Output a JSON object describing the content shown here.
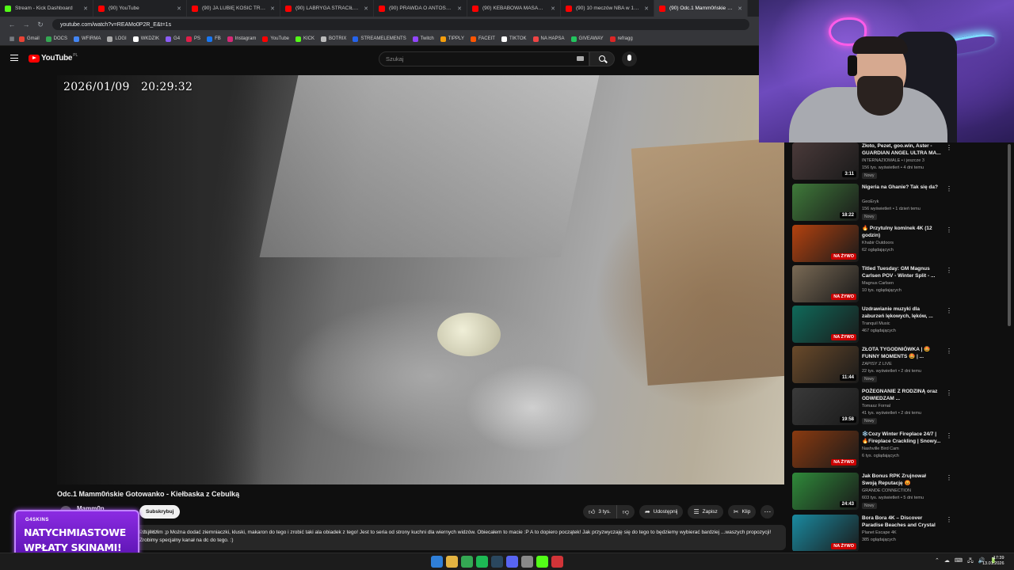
{
  "browser": {
    "tabs": [
      {
        "label": "Stream - Kick Dashboard",
        "color": "#53fc18"
      },
      {
        "label": "(90) YouTube",
        "color": "#ff0000"
      },
      {
        "label": "(90) JA LUBIĘ KOSIĆ TRAWĘ | C",
        "color": "#ff0000"
      },
      {
        "label": "(90) LABRYGA STRACIŁ KONTR",
        "color": "#ff0000"
      },
      {
        "label": "(90) PRAWDA O ANTOSIACH",
        "color": "#ff0000"
      },
      {
        "label": "(90) KEBABOWA MASAKRA W",
        "color": "#ff0000"
      },
      {
        "label": "(90) 10 meczów NBA w 100 go",
        "color": "#ff0000"
      },
      {
        "label": "(90) Odc.1 Mamm0ńskie Go",
        "color": "#ff0000"
      }
    ],
    "url": "youtube.com/watch?v=REAMo0P2R_E&t=1s",
    "bookmarks": [
      "Gmail",
      "DOCS",
      "WFIRMA",
      "LOGI",
      "WKDZIK",
      "G4",
      "PS",
      "FB",
      "Instagram",
      "YouTube",
      "KICK",
      "BOTRIX",
      "STREAMELEMENTS",
      "Twitch",
      "TIPPLY",
      "FACEIT",
      "TIKTOK",
      "NA HAPSA",
      "GIVEAWAY",
      "refragg"
    ]
  },
  "youtube": {
    "logo_text": "YouTube",
    "country": "PL",
    "search_placeholder": "Szukaj"
  },
  "video": {
    "timestamp": "2026/01/09   20:29:32",
    "title": "Odc.1 Mamm0ńskie Gotowanko - Kiełbaska z Cebulką",
    "channel": "Mamm0n",
    "subscribe": "Subskrybuj",
    "likes": "3 tys.",
    "share": "Udostępnij",
    "save": "Zapisz",
    "clip": "Klip",
    "description_country": "POLSKA",
    "description": "...h jedzim ;p Można dodać ziemniaczki, kluski, makaron do tego i zrobić taki ala obiadek z tego! Jest to seria od strony kuchni dla wiernych widzów. Obiecałem to macie :P A to dopiero początek! Jak przyzwyczaję się do tego to będziemy wybierać bardziej ...waszych propozycji! Zrobimy specjalny kanał na dc do tego. :)"
  },
  "recommendations": [
    {
      "title": "Złoto, Pezet, goo.win, Aster - GUARDIAN ANGEL ULTRA MA...",
      "channel": "INTERNAZIOMALE • i jeszcze 3",
      "meta": "156 tys. wyświetleń • 4 dni temu",
      "badge": "Nowy",
      "duration": "3:11",
      "live": "",
      "thumb": "#4a3a3a"
    },
    {
      "title": "Nigeria na Ghanie? Tak się da?",
      "channel": "GeoEryk",
      "meta": "156 wyświetleń • 1 dzień temu",
      "badge": "Nowy",
      "duration": "18:22",
      "live": "",
      "thumb": "#3f7a3a"
    },
    {
      "title": "🔥 Przytulny kominek 4K (12 godzin)",
      "channel": "Khabir Outdoors",
      "meta": "62 oglądających",
      "badge": "",
      "duration": "",
      "live": "NA ŻYWO",
      "thumb": "#b4420f"
    },
    {
      "title": "Titled Tuesday: GM Magnus Carlsen POV - Winter Split - ...",
      "channel": "Magnus Carlsen",
      "meta": "10 tys. oglądających",
      "badge": "",
      "duration": "",
      "live": "NA ŻYWO",
      "thumb": "#7a6a55"
    },
    {
      "title": "Uzdrawianie muzyki dla zaburzeń lękowych, lęków, ...",
      "channel": "Tranquil Music",
      "meta": "467 oglądających",
      "badge": "",
      "duration": "",
      "live": "NA ŻYWO",
      "thumb": "#0f6a5a"
    },
    {
      "title": "ZŁOTA TYGODNIÓWKA | 🤩 FUNNY MOMENTS 🤩 | ...",
      "channel": "ZAPISY Z LIVE",
      "meta": "22 tys. wyświetleń • 2 dni temu",
      "badge": "Nowy",
      "duration": "11:44",
      "live": "",
      "thumb": "#6a4a2a"
    },
    {
      "title": "POŻEGNANIE Z RODZINĄ oraz ODWIEDZAM ...",
      "channel": "Tomasz Fornal",
      "meta": "41 tys. wyświetleń • 2 dni temu",
      "badge": "Nowy",
      "duration": "19:58",
      "live": "",
      "thumb": "#3a3a3a"
    },
    {
      "title": "❄️Cozy Winter Fireplace 24/7 | 🔥Fireplace Crackling | Snowy...",
      "channel": "Nashville Bird Cam",
      "meta": "6 tys. oglądających",
      "badge": "",
      "duration": "",
      "live": "NA ŻYWO",
      "thumb": "#8a3a10"
    },
    {
      "title": "Jak Bonus RPK Zrujnował Swoją Reputację 😡",
      "channel": "GRANDE CONNECTION",
      "meta": "603 tys. wyświetleń • 5 dni temu",
      "badge": "Nowy",
      "duration": "24:43",
      "live": "",
      "thumb": "#2f8a3a"
    },
    {
      "title": "Bora Bora 4K – Discover Paradise Beaches and Crystal ...",
      "channel": "Planet Escape 4K",
      "meta": "385 oglądających",
      "badge": "",
      "duration": "",
      "live": "NA ŻYWO",
      "thumb": "#1a8aa0"
    }
  ],
  "promo": {
    "brand": "G4SKINS",
    "line1": "NATYCHMIASTOWE",
    "line2": "WPŁATY SKINAMI!"
  },
  "taskbar": {
    "icons": [
      "#2f7fd8",
      "#e3b341",
      "#34a853",
      "#1db954",
      "#2a475e",
      "#5865f2",
      "#888888",
      "#53fc18",
      "#d13438"
    ],
    "tray": [
      "⌃",
      "☁",
      "⌨",
      "🖧",
      "🔊",
      "🔋"
    ],
    "time": "17:39",
    "date": "13.01.2026"
  }
}
